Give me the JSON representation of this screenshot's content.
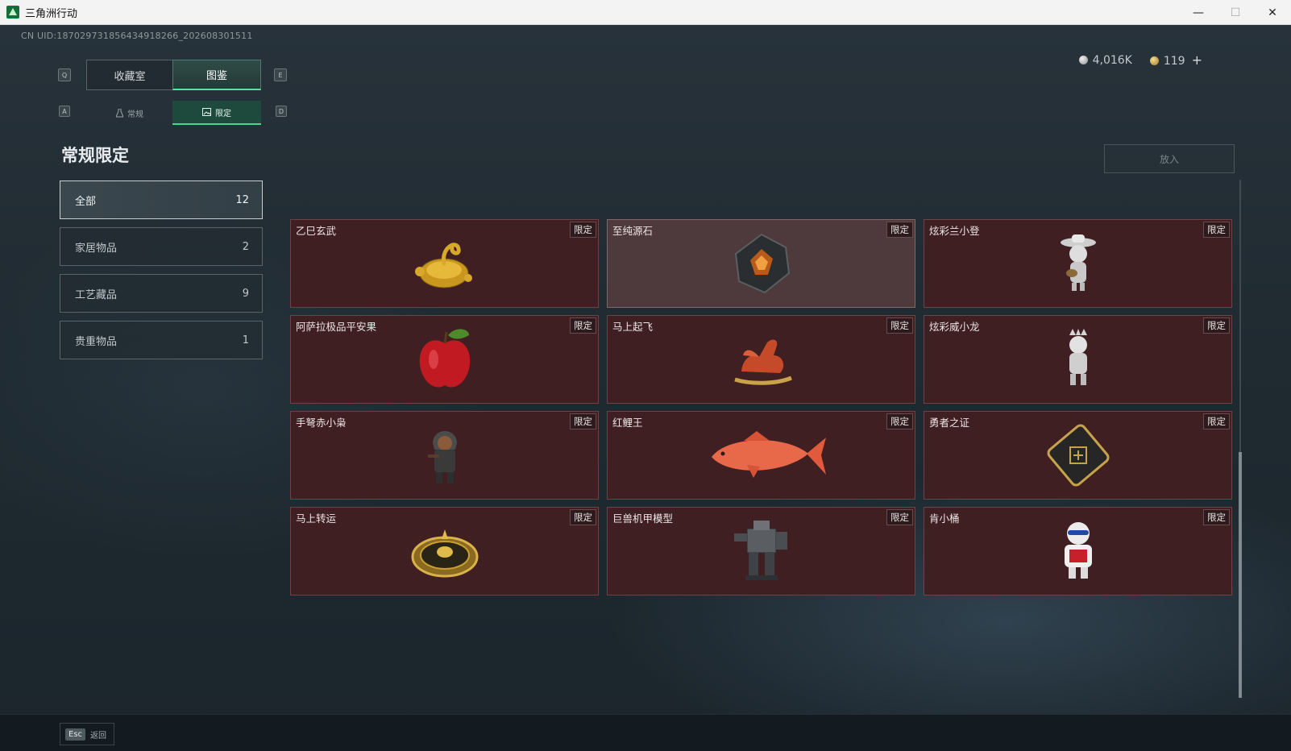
{
  "window": {
    "title": "三角洲行动",
    "minimize": "—",
    "maximize": "☐",
    "close": "✕"
  },
  "uid": "CN UID:1870297318564349182​66_202608301511",
  "currency": {
    "silver": "4,016K",
    "gold": "119",
    "add": "+"
  },
  "keys": {
    "prev_tab": "Q",
    "next_tab": "E",
    "prev_sub": "A",
    "next_sub": "D"
  },
  "tabs": [
    {
      "label": "收藏室",
      "active": false
    },
    {
      "label": "图鉴",
      "active": true
    }
  ],
  "subtabs": [
    {
      "label": "常规",
      "icon": "flask-icon",
      "active": false
    },
    {
      "label": "限定",
      "icon": "image-icon",
      "active": true
    }
  ],
  "section_title": "常规限定",
  "categories": [
    {
      "label": "全部",
      "count": "12",
      "active": true
    },
    {
      "label": "家居物品",
      "count": "2",
      "active": false
    },
    {
      "label": "工艺藏品",
      "count": "9",
      "active": false
    },
    {
      "label": "贵重物品",
      "count": "1",
      "active": false
    }
  ],
  "put_button": "放入",
  "tag": "限定",
  "items": [
    {
      "name": "乙巳玄武",
      "icon": "golden-serpent-turtle-icon"
    },
    {
      "name": "至纯源石",
      "icon": "crystal-stone-icon",
      "highlight": true
    },
    {
      "name": "炫彩兰小登",
      "icon": "sombrero-figurine-icon"
    },
    {
      "name": "阿萨拉极品平安果",
      "icon": "red-apple-icon"
    },
    {
      "name": "马上起飞",
      "icon": "red-horse-icon"
    },
    {
      "name": "炫彩威小龙",
      "icon": "dragon-figurine-icon"
    },
    {
      "name": "手弩赤小枭",
      "icon": "hooded-figurine-icon"
    },
    {
      "name": "红鲤王",
      "icon": "red-carp-icon"
    },
    {
      "name": "勇者之证",
      "icon": "badge-card-icon"
    },
    {
      "name": "马上转运",
      "icon": "golden-wheel-icon"
    },
    {
      "name": "巨兽机甲模型",
      "icon": "mech-model-icon"
    },
    {
      "name": "肯小桶",
      "icon": "colonel-figurine-icon"
    }
  ],
  "bottom": {
    "esc_key": "Esc",
    "esc_label": "返回"
  },
  "colors": {
    "accent": "#5fe0a0",
    "card_bg": "#3f1f21",
    "card_highlight": "#4e393c"
  }
}
